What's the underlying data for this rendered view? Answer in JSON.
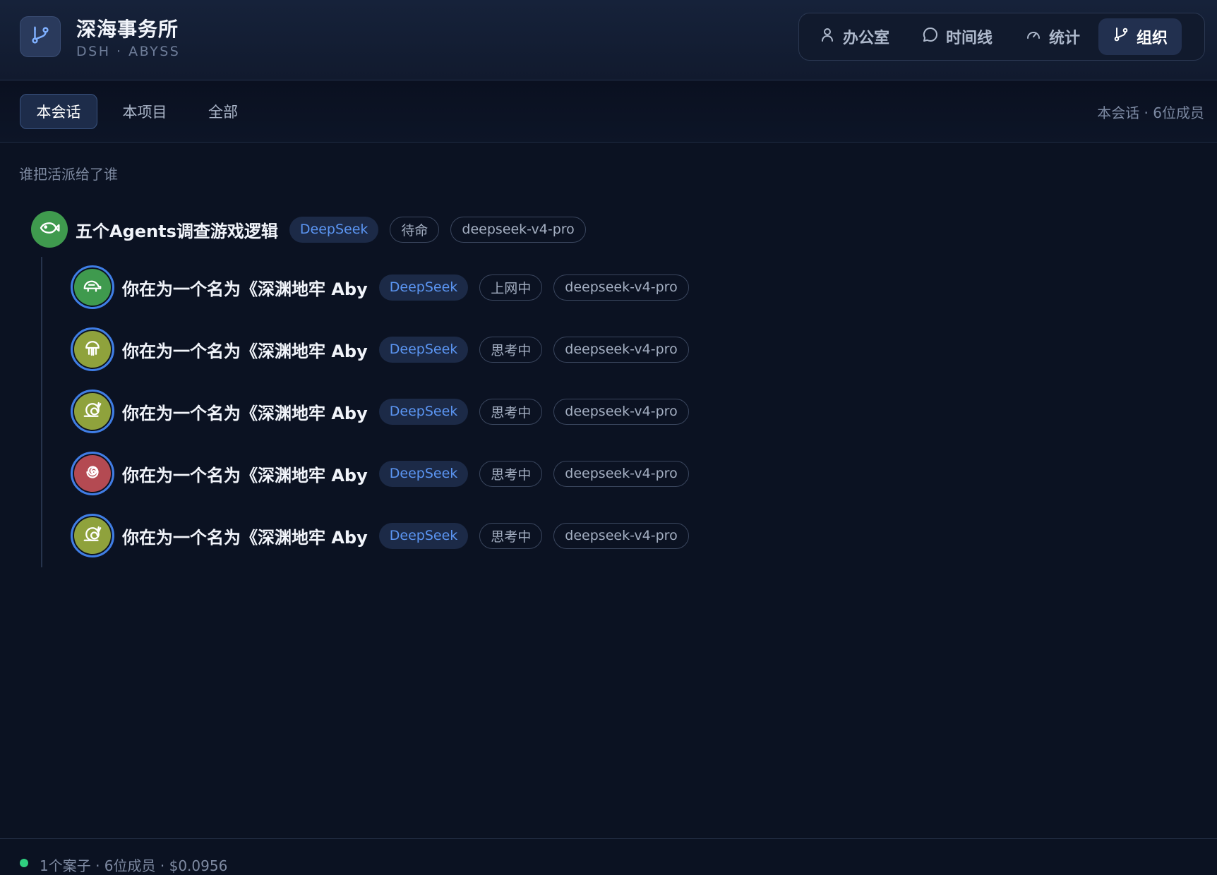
{
  "brand": {
    "title": "深海事务所",
    "subtitle": "DSH · ABYSS",
    "logo_icon": "git-branch-icon"
  },
  "nav": {
    "items": [
      {
        "label": "办公室",
        "icon": "user-icon",
        "active": false
      },
      {
        "label": "时间线",
        "icon": "chat-bubble-icon",
        "active": false
      },
      {
        "label": "统计",
        "icon": "gauge-icon",
        "active": false
      },
      {
        "label": "组织",
        "icon": "git-branch-icon",
        "active": true
      }
    ]
  },
  "tabs": {
    "items": [
      {
        "label": "本会话",
        "active": true
      },
      {
        "label": "本项目",
        "active": false
      },
      {
        "label": "全部",
        "active": false
      }
    ],
    "summary": "本会话 · 6位成员"
  },
  "content": {
    "caption": "谁把活派给了谁",
    "root": {
      "title": "五个Agents调查游戏逻辑",
      "provider": "DeepSeek",
      "status": "待命",
      "model": "deepseek-v4-pro",
      "avatar_icon": "fish-icon",
      "avatar_color": "#3f9a4e"
    },
    "children": [
      {
        "title": "你在为一个名为《深渊地牢 Aby",
        "provider": "DeepSeek",
        "status": "上网中",
        "model": "deepseek-v4-pro",
        "avatar_icon": "turtle-icon",
        "avatar_color": "#3f9a4e"
      },
      {
        "title": "你在为一个名为《深渊地牢 Aby",
        "provider": "DeepSeek",
        "status": "思考中",
        "model": "deepseek-v4-pro",
        "avatar_icon": "jellyfish-icon",
        "avatar_color": "#8fa23c"
      },
      {
        "title": "你在为一个名为《深渊地牢 Aby",
        "provider": "DeepSeek",
        "status": "思考中",
        "model": "deepseek-v4-pro",
        "avatar_icon": "snail-icon",
        "avatar_color": "#8fa23c"
      },
      {
        "title": "你在为一个名为《深渊地牢 Aby",
        "provider": "DeepSeek",
        "status": "思考中",
        "model": "deepseek-v4-pro",
        "avatar_icon": "spiral-icon",
        "avatar_color": "#b44a52"
      },
      {
        "title": "你在为一个名为《深渊地牢 Aby",
        "provider": "DeepSeek",
        "status": "思考中",
        "model": "deepseek-v4-pro",
        "avatar_icon": "snail-icon",
        "avatar_color": "#8fa23c"
      }
    ]
  },
  "footer": {
    "summary": "1个案子 · 6位成员 · $0.0956",
    "status_color": "#2fcf7f"
  },
  "colors": {
    "accent": "#3f7de6",
    "provider_text": "#5b95f2",
    "background": "#0b1222"
  }
}
